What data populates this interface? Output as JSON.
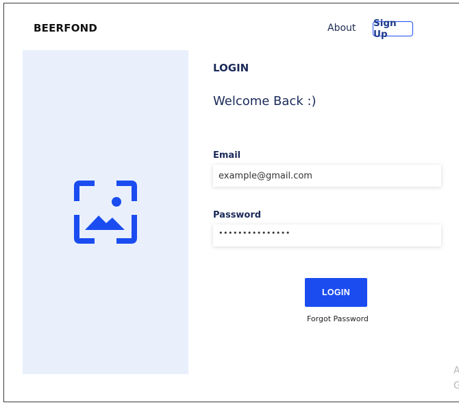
{
  "header": {
    "brand": "BEERFOND",
    "nav": {
      "about": "About",
      "signup": "Sign Up"
    }
  },
  "hero": {
    "icon": "image-placeholder-icon",
    "accent_color": "#1a4cf0",
    "panel_color": "#e9f0fc"
  },
  "form": {
    "title": "LOGIN",
    "welcome": "Welcome Back :)",
    "email": {
      "label": "Email",
      "value": "example@gmail.com"
    },
    "password": {
      "label": "Password",
      "value": "•••••••••••••••"
    },
    "submit_label": "LOGIN",
    "forgot_label": "Forgot Password"
  },
  "corner": {
    "line1": "A",
    "line2": "G"
  }
}
